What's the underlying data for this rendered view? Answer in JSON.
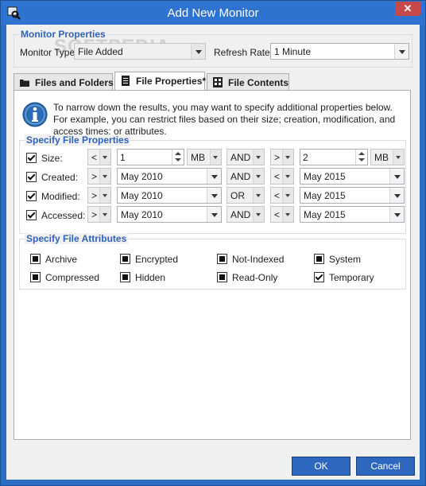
{
  "window": {
    "title": "Add New Monitor",
    "close_glyph": "✕"
  },
  "monitor_properties": {
    "group_title": "Monitor Properties",
    "type_label": "Monitor Type:",
    "type_value": "File Added",
    "refresh_label": "Refresh Rate:",
    "refresh_value": "1 Minute",
    "watermark": "SOFTPEDIA"
  },
  "tabs": [
    {
      "label": "Files and Folders",
      "icon": "folder-icon",
      "active": false
    },
    {
      "label": "File Properties*",
      "icon": "document-icon",
      "active": true
    },
    {
      "label": "File Contents",
      "icon": "file-contents-icon",
      "active": false
    }
  ],
  "info_text": "To narrow down the results, you may want to specify additional properties below. For example, you can restrict files based on their size; creation, modification, and access times; or attributes.",
  "properties": {
    "group_title": "Specify File Properties",
    "rows": [
      {
        "label": "Size:",
        "checked": true,
        "op1": "<",
        "val1": "1",
        "unit1": "MB",
        "conj": "AND",
        "op2": ">",
        "val2": "2",
        "unit2": "MB"
      },
      {
        "label": "Created:",
        "checked": true,
        "op1": ">",
        "val1": "May 2010",
        "conj": "AND",
        "op2": "<",
        "val2": "May 2015"
      },
      {
        "label": "Modified:",
        "checked": true,
        "op1": ">",
        "val1": "May 2010",
        "conj": "OR",
        "op2": "<",
        "val2": "May 2015"
      },
      {
        "label": "Accessed:",
        "checked": true,
        "op1": ">",
        "val1": "May 2010",
        "conj": "AND",
        "op2": "<",
        "val2": "May 2015"
      }
    ]
  },
  "attributes": {
    "group_title": "Specify File Attributes",
    "items": [
      {
        "label": "Archive",
        "state": "indeterminate"
      },
      {
        "label": "Encrypted",
        "state": "indeterminate"
      },
      {
        "label": "Not-Indexed",
        "state": "indeterminate"
      },
      {
        "label": "System",
        "state": "indeterminate"
      },
      {
        "label": "Compressed",
        "state": "indeterminate"
      },
      {
        "label": "Hidden",
        "state": "indeterminate"
      },
      {
        "label": "Read-Only",
        "state": "indeterminate"
      },
      {
        "label": "Temporary",
        "state": "checked"
      }
    ]
  },
  "buttons": {
    "ok": "OK",
    "cancel": "Cancel"
  },
  "colors": {
    "titlebar": "#2f73d0",
    "accent_text": "#2f63b9",
    "close": "#c74848",
    "button": "#2d67be"
  }
}
